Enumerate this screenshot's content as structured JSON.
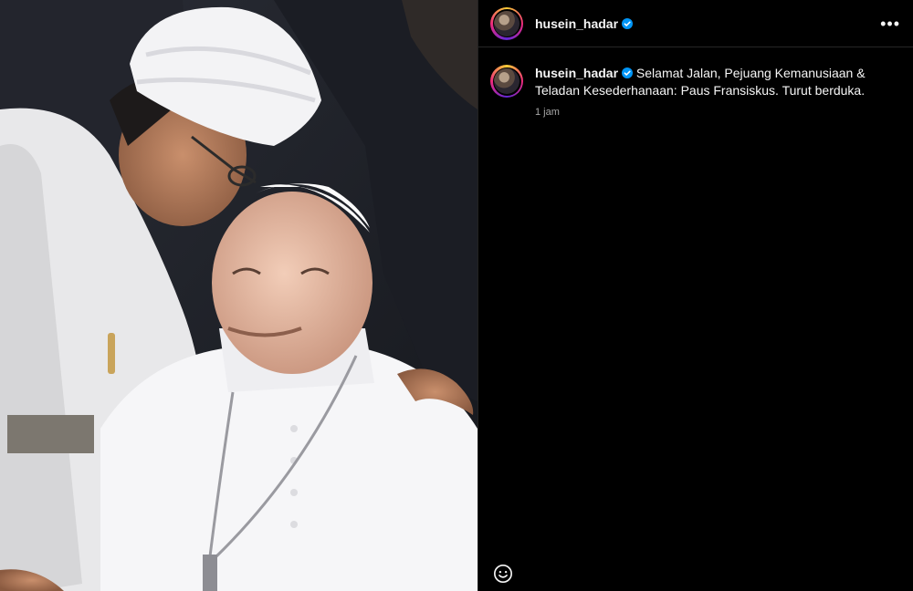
{
  "post": {
    "username": "husein_hadar",
    "more_icon": "more-horizontal-icon",
    "caption": "Selamat Jalan, Pejuang Kemanusiaan & Teladan Kesederhanaan: Paus Fransiskus. Turut berduka.",
    "time": "1 jam",
    "verified_color": "#0095f6"
  },
  "composer": {
    "emoji_icon": "smiley-icon"
  }
}
